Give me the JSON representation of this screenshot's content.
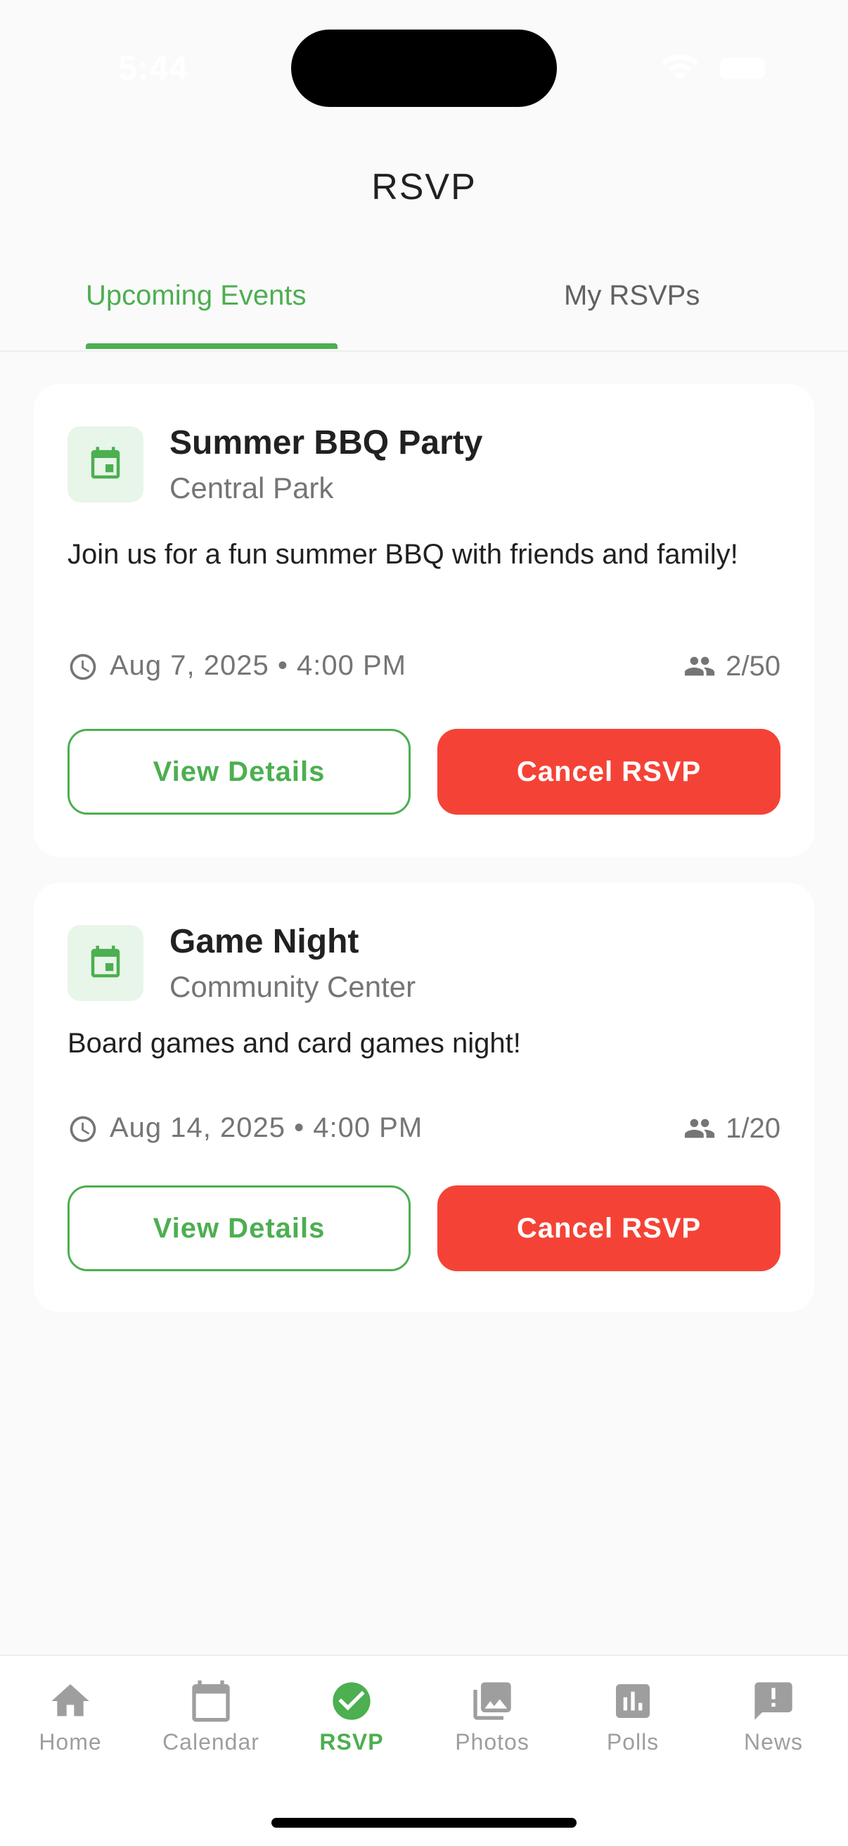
{
  "status_bar": {
    "time": "5:44"
  },
  "header": {
    "title": "RSVP"
  },
  "tabs": [
    {
      "label": "Upcoming Events",
      "active": true
    },
    {
      "label": "My RSVPs",
      "active": false
    }
  ],
  "events": [
    {
      "title": "Summer BBQ Party",
      "location": "Central Park",
      "description": "Join us for a fun summer BBQ with friends and family!",
      "datetime": "Aug 7, 2025 • 4:00 PM",
      "attendees": "2/50",
      "details_label": "View Details",
      "cancel_label": "Cancel RSVP"
    },
    {
      "title": "Game Night",
      "location": "Community Center",
      "description": "Board games and card games night!",
      "datetime": "Aug 14, 2025 • 4:00 PM",
      "attendees": "1/20",
      "details_label": "View Details",
      "cancel_label": "Cancel RSVP"
    }
  ],
  "bottom_nav": [
    {
      "label": "Home",
      "icon": "home-icon",
      "active": false
    },
    {
      "label": "Calendar",
      "icon": "calendar-icon",
      "active": false
    },
    {
      "label": "RSVP",
      "icon": "check-circle-icon",
      "active": true
    },
    {
      "label": "Photos",
      "icon": "photo-library-icon",
      "active": false
    },
    {
      "label": "Polls",
      "icon": "poll-icon",
      "active": false
    },
    {
      "label": "News",
      "icon": "announcement-icon",
      "active": false
    }
  ],
  "colors": {
    "accent": "#4caf50",
    "danger": "#f44336",
    "background": "#fafafa",
    "muted_text": "#757575",
    "inactive_nav": "#9e9e9e"
  }
}
